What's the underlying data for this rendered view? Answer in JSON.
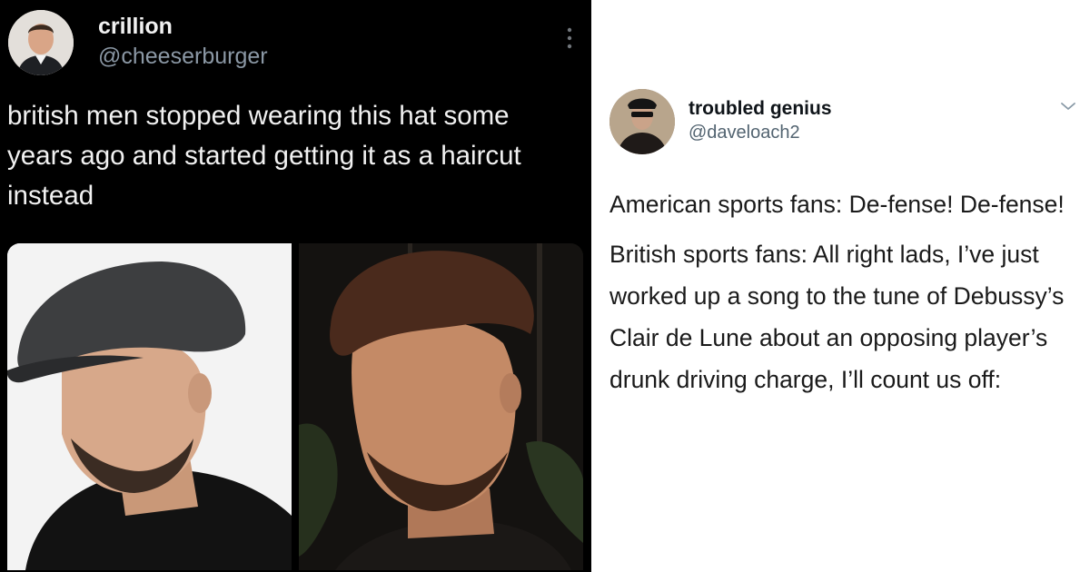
{
  "left_tweet": {
    "author_name": "crillion",
    "author_handle": "@cheeserburger",
    "text": "british men stopped wearing this hat some years ago and started getting it as a haircut instead",
    "more_icon": "vertical-ellipsis-icon",
    "theme_background": "#000000"
  },
  "right_tweet": {
    "author_name": "troubled genius",
    "author_handle": "@daveloach2",
    "paragraph_1": "American sports fans: De-fense! De-fense!",
    "paragraph_2": "British sports fans: All right lads, I’ve just worked up a song to the tune of Debussy’s Clair de Lune about an opposing player’s drunk driving charge, I’ll count us off:",
    "menu_icon": "chevron-down-icon",
    "theme_background": "#ffffff"
  }
}
